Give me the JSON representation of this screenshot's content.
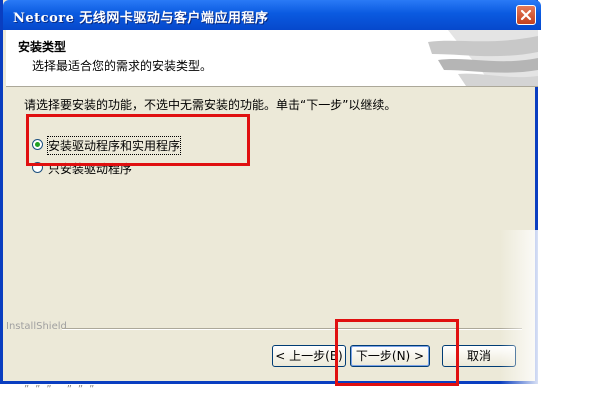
{
  "window": {
    "title": "Netcore 无线网卡驱动与客户端应用程序"
  },
  "header": {
    "title": "安装类型",
    "subtitle": "选择最适合您的需求的安装类型。"
  },
  "body": {
    "instruction": "请选择要安装的功能，不选中无需安装的功能。单击“下一步”以继续。",
    "options": [
      {
        "label": "安装驱动程序和实用程序",
        "selected": true
      },
      {
        "label": "只安装驱动程序",
        "selected": false
      }
    ]
  },
  "footer": {
    "brand": "InstallShield",
    "back_label": "< 上一步(B)",
    "next_label": "下一步(N) >",
    "cancel_label": "取消"
  },
  "bottom_text": "””” ”””"
}
